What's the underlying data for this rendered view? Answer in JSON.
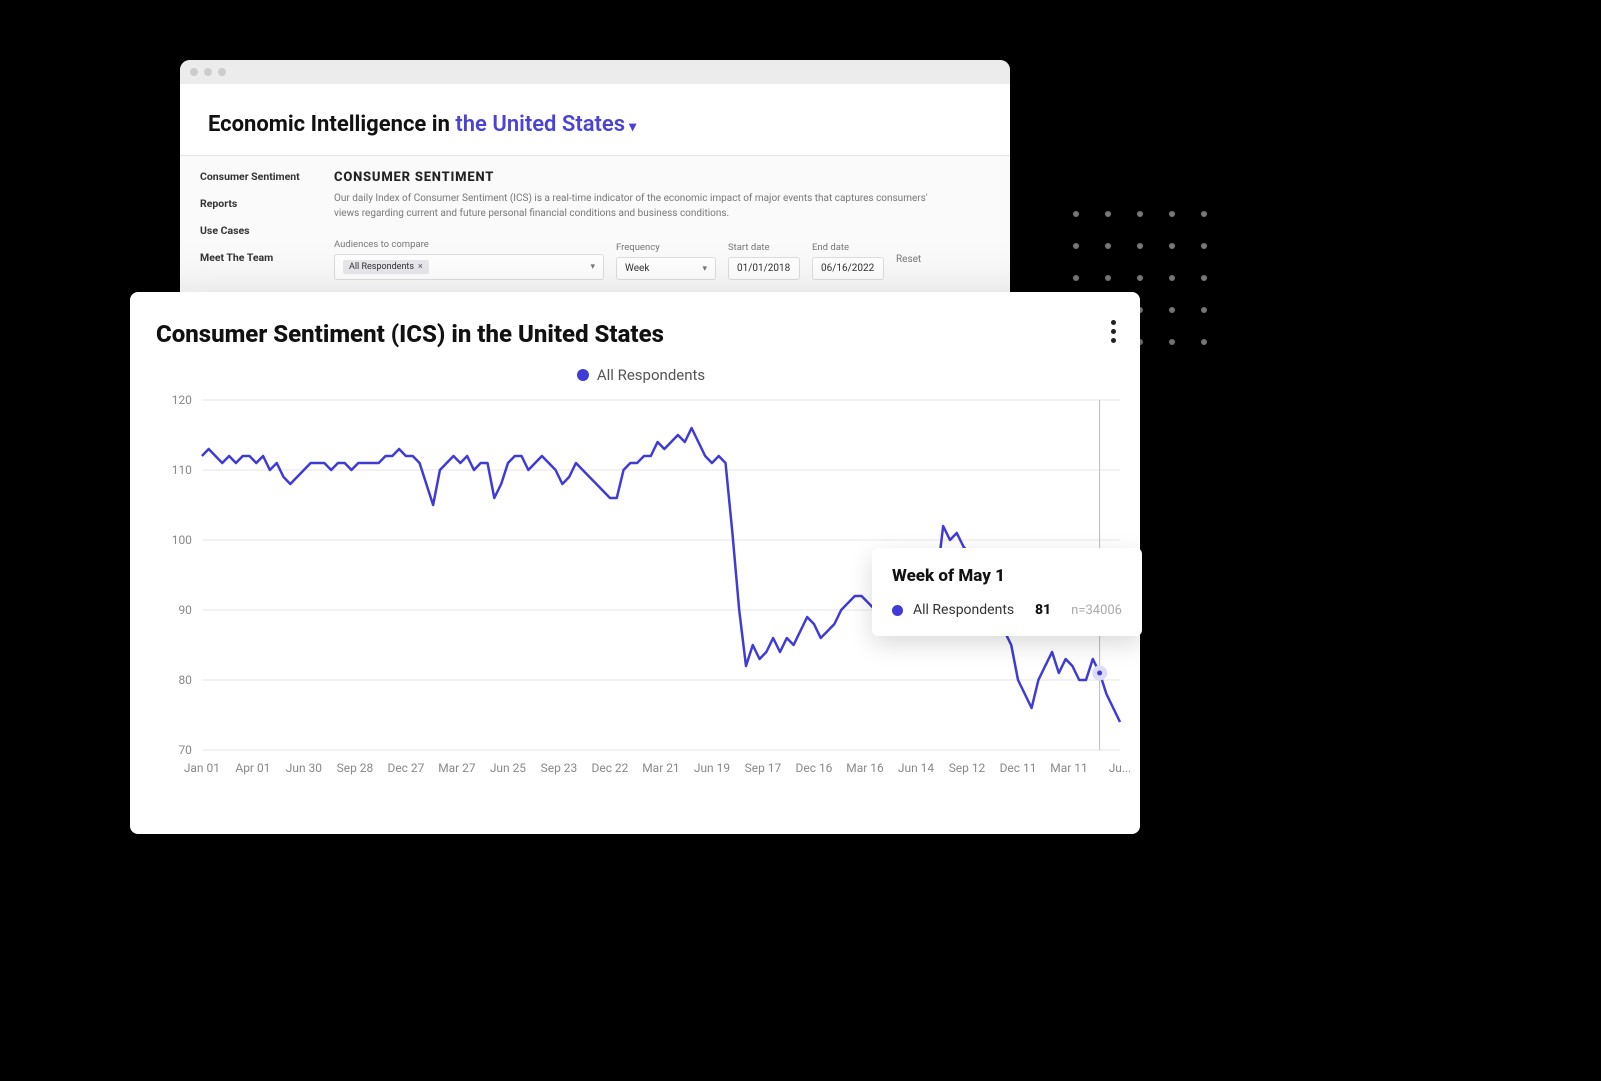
{
  "header": {
    "prefix": "Economic Intelligence in ",
    "region": "the United States",
    "chevron": "▾"
  },
  "sidebar": {
    "items": [
      {
        "label": "Consumer Sentiment"
      },
      {
        "label": "Reports"
      },
      {
        "label": "Use Cases"
      },
      {
        "label": "Meet The Team"
      }
    ]
  },
  "main": {
    "section_title": "CONSUMER SENTIMENT",
    "section_desc": "Our daily Index of Consumer Sentiment (ICS) is a real-time indicator of the economic impact of major events that captures consumers' views regarding current and future personal financial conditions and business conditions."
  },
  "filters": {
    "audiences": {
      "label": "Audiences to compare",
      "chip": "All Respondents",
      "remove": "×"
    },
    "frequency": {
      "label": "Frequency",
      "value": "Week"
    },
    "start_date": {
      "label": "Start date",
      "value": "01/01/2018"
    },
    "end_date": {
      "label": "End date",
      "value": "06/16/2022"
    },
    "reset": "Reset"
  },
  "chart": {
    "title": "Consumer Sentiment (ICS) in the United States",
    "legend_label": "All Respondents"
  },
  "tooltip": {
    "title": "Week of May 1",
    "series": "All Respondents",
    "value": "81",
    "n": "n=34006"
  },
  "chart_data": {
    "type": "line",
    "title": "Consumer Sentiment (ICS) in the United States",
    "xlabel": "",
    "ylabel": "",
    "ylim": [
      70,
      120
    ],
    "y_ticks": [
      70,
      80,
      90,
      100,
      110,
      120
    ],
    "x_ticks": [
      "Jan 01",
      "Apr 01",
      "Jun 30",
      "Sep 28",
      "Dec 27",
      "Mar 27",
      "Jun 25",
      "Sep 23",
      "Dec 22",
      "Mar 21",
      "Jun 19",
      "Sep 17",
      "Dec 16",
      "Mar 16",
      "Jun 14",
      "Sep 12",
      "Dec 11",
      "Mar 11",
      "Ju..."
    ],
    "series": [
      {
        "name": "All Respondents",
        "color": "#3f3bd6",
        "values": [
          112,
          113,
          112,
          111,
          112,
          111,
          112,
          112,
          111,
          112,
          110,
          111,
          109,
          108,
          109,
          110,
          111,
          111,
          111,
          110,
          111,
          111,
          110,
          111,
          111,
          111,
          111,
          112,
          112,
          113,
          112,
          112,
          111,
          108,
          105,
          110,
          111,
          112,
          111,
          112,
          110,
          111,
          111,
          106,
          108,
          111,
          112,
          112,
          110,
          111,
          112,
          111,
          110,
          108,
          109,
          111,
          110,
          109,
          108,
          107,
          106,
          106,
          110,
          111,
          111,
          112,
          112,
          114,
          113,
          114,
          115,
          114,
          116,
          114,
          112,
          111,
          112,
          111,
          101,
          90,
          82,
          85,
          83,
          84,
          86,
          84,
          86,
          85,
          87,
          89,
          88,
          86,
          87,
          88,
          90,
          91,
          92,
          92,
          91,
          90,
          88,
          87,
          87,
          87,
          88,
          90,
          92,
          91,
          94,
          102,
          100,
          101,
          99,
          98,
          94,
          91,
          89,
          88,
          87,
          85,
          80,
          78,
          76,
          80,
          82,
          84,
          81,
          83,
          82,
          80,
          80,
          83,
          81,
          78,
          76,
          74
        ]
      }
    ],
    "highlight": {
      "x_label": "Week of May 1",
      "value": 81,
      "n": 34006
    }
  }
}
